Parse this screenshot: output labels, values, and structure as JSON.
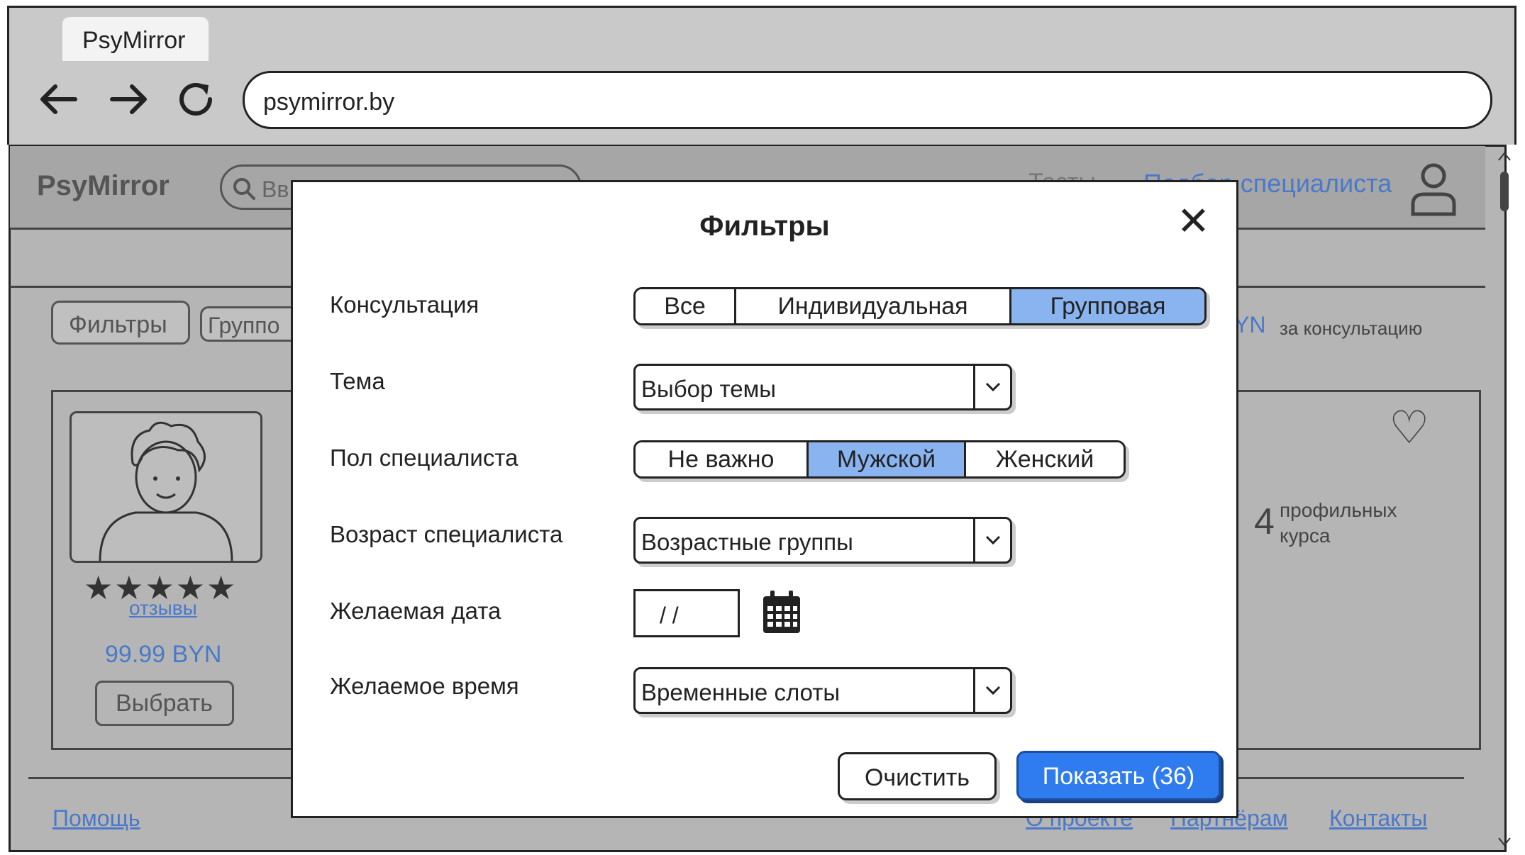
{
  "browser": {
    "tab_title": "PsyMirror",
    "url": "psymirror.by"
  },
  "page": {
    "logo": "PsyMirror",
    "search_placeholder": "Вв",
    "nav_tests": "Тесты",
    "nav_selection": "Подбор специалиста",
    "filters_pill": "Фильтры",
    "group_pill": "Группо",
    "price_header_unit": "YN",
    "price_header_text": "за консультацию",
    "card": {
      "stars": "★★★★★",
      "reviews": "отзывы",
      "price": "99.99 BYN",
      "choose": "Выбрать",
      "heart": "♡",
      "courses_count": "4",
      "courses_label_1": "профильных",
      "courses_label_2": "курса"
    },
    "footer": {
      "help": "Помощь",
      "about": "О проекте",
      "partners": "Партнёрам",
      "contacts": "Контакты"
    }
  },
  "modal": {
    "title": "Фильтры",
    "close": "✕",
    "consultation": {
      "label": "Консультация",
      "options": [
        "Все",
        "Индивидуальная",
        "Групповая"
      ],
      "selected": "Групповая"
    },
    "topic": {
      "label": "Тема",
      "value": "Выбор темы"
    },
    "gender": {
      "label": "Пол специалиста",
      "options": [
        "Не важно",
        "Мужской",
        "Женский"
      ],
      "selected": "Мужской"
    },
    "age": {
      "label": "Возраст специалиста",
      "value": "Возрастные группы"
    },
    "date": {
      "label": "Желаемая дата",
      "value": "/ /"
    },
    "time": {
      "label": "Желаемое время",
      "value": "Временные слоты"
    },
    "clear_button": "Очистить",
    "show_button": "Показать (36)"
  },
  "colors": {
    "accent": "#2f7cf0",
    "selected_segment": "#8ab4f0",
    "link": "#4a79c9"
  }
}
